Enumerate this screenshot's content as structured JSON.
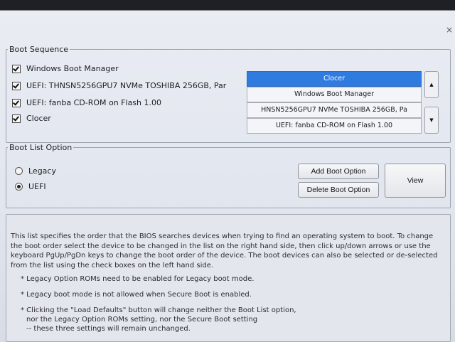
{
  "boot_sequence": {
    "legend": "Boot Sequence",
    "checkbox_items": [
      {
        "label": "Windows Boot Manager",
        "checked": true
      },
      {
        "label": "UEFI: THNSN5256GPU7 NVMe TOSHIBA 256GB, Par",
        "checked": true
      },
      {
        "label": "UEFI: fanba CD-ROM on Flash 1.00",
        "checked": true
      },
      {
        "label": "Clocer",
        "checked": true
      }
    ],
    "order_list": [
      {
        "label": "Clocer",
        "selected": true
      },
      {
        "label": "Windows Boot Manager",
        "selected": false
      },
      {
        "label": "HNSN5256GPU7 NVMe TOSHIBA 256GB, Pa",
        "selected": false
      },
      {
        "label": "UEFI: fanba CD-ROM on Flash 1.00",
        "selected": false
      }
    ],
    "up_glyph": "▲",
    "down_glyph": "▼"
  },
  "boot_list_option": {
    "legend": "Boot List Option",
    "options": [
      {
        "label": "Legacy",
        "selected": false
      },
      {
        "label": "UEFI",
        "selected": true
      }
    ],
    "add_button": "Add Boot Option",
    "delete_button": "Delete Boot Option",
    "view_button": "View"
  },
  "info": {
    "paragraph": "This list specifies the order that the BIOS searches devices when trying to find an operating system to boot. To change the boot order select the device to be changed in the list on the right hand side, then click up/down arrows or use the keyboard PgUp/PgDn keys to change the boot order of the device. The boot devices can also be selected or de-selected from the list using the check boxes on the left hand side.",
    "bullet1": "* Legacy Option ROMs need to be enabled for Legacy boot mode.",
    "bullet2": "* Legacy boot mode is not allowed when Secure Boot is enabled.",
    "bullet3_line1": "* Clicking the \"Load Defaults\" button will change neither the Boot List option,",
    "bullet3_line2": "nor the Legacy Option ROMs setting, nor the Secure Boot setting",
    "bullet3_line3": "-- these three settings will remain unchanged."
  },
  "close_glyph": "×",
  "colors": {
    "selected": "#2f7be0",
    "background": "#e6e9f0"
  }
}
